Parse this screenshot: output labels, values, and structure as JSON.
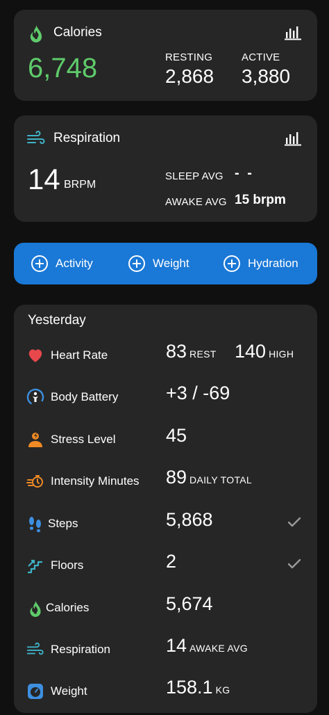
{
  "calories_card": {
    "title": "Calories",
    "icon": "flame-icon",
    "total": "6,748",
    "resting_label": "RESTING",
    "resting_value": "2,868",
    "active_label": "ACTIVE",
    "active_value": "3,880"
  },
  "respiration_card": {
    "title": "Respiration",
    "icon": "wind-icon",
    "value": "14",
    "unit": "BRPM",
    "sleep_label": "SLEEP AVG",
    "sleep_value": "- -",
    "awake_label": "AWAKE AVG",
    "awake_value": "15 brpm"
  },
  "quick_add": {
    "activity": "Activity",
    "weight": "Weight",
    "hydration": "Hydration"
  },
  "yesterday": {
    "title": "Yesterday",
    "rows": [
      {
        "label": "Heart Rate",
        "value": "83",
        "unit": "REST",
        "value2": "140",
        "unit2": "HIGH",
        "icon": "heart-icon"
      },
      {
        "label": "Body Battery",
        "value": "+3 / -69",
        "icon": "body-battery-icon"
      },
      {
        "label": "Stress Level",
        "value": "45",
        "icon": "stress-icon"
      },
      {
        "label": "Intensity Minutes",
        "value": "89",
        "unit": "DAILY TOTAL",
        "icon": "intensity-icon"
      },
      {
        "label": "Steps",
        "value": "5,868",
        "icon": "footsteps-icon",
        "checked": true
      },
      {
        "label": "Floors",
        "value": "2",
        "icon": "stairs-icon",
        "checked": true
      },
      {
        "label": "Calories",
        "value": "5,674",
        "icon": "flame-icon"
      },
      {
        "label": "Respiration",
        "value": "14",
        "unit": "AWAKE AVG",
        "icon": "wind-icon"
      },
      {
        "label": "Weight",
        "value": "158.1",
        "unit": "KG",
        "icon": "scale-icon"
      }
    ]
  },
  "colors": {
    "background": "#101010",
    "card": "#262626",
    "accent_blue": "#1a78d6",
    "calories_green": "#5fcb6b",
    "heart_red": "#e8474c",
    "stress_orange": "#f08a24",
    "respiration_teal": "#3fb4c8",
    "steps_blue": "#3d8fe0"
  }
}
